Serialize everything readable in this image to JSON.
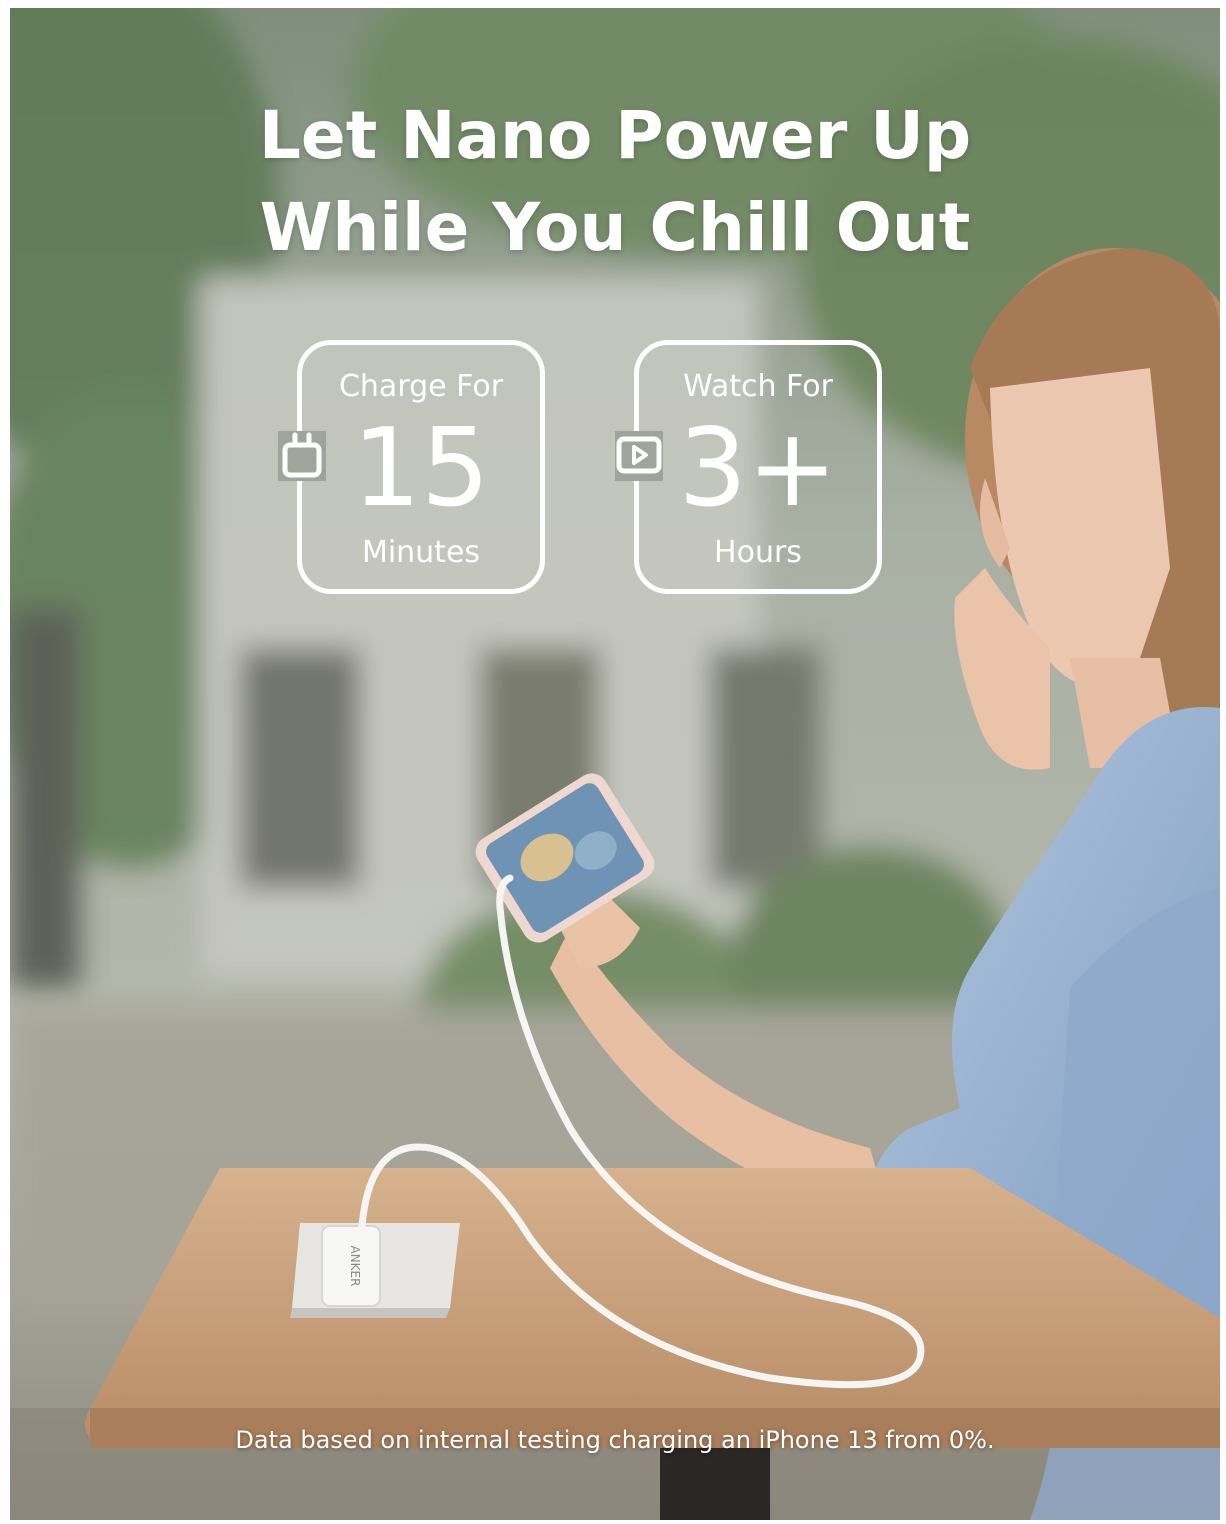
{
  "headline": {
    "line1": "Let Nano Power Up",
    "line2": "While You Chill Out"
  },
  "stats": [
    {
      "icon": "plug-icon",
      "top": "Charge For",
      "value": "15",
      "bottom": "Minutes"
    },
    {
      "icon": "play-video-icon",
      "top": "Watch For",
      "value": "3+",
      "bottom": "Hours"
    }
  ],
  "product_brand": "ANKER",
  "footnote": "Data based on internal testing charging an iPhone 13 from 0%.",
  "colors": {
    "text": "#ffffff",
    "table_wood": "#c9a27c",
    "shirt": "#9fb8d6",
    "background_tint": "#a6aea1"
  }
}
